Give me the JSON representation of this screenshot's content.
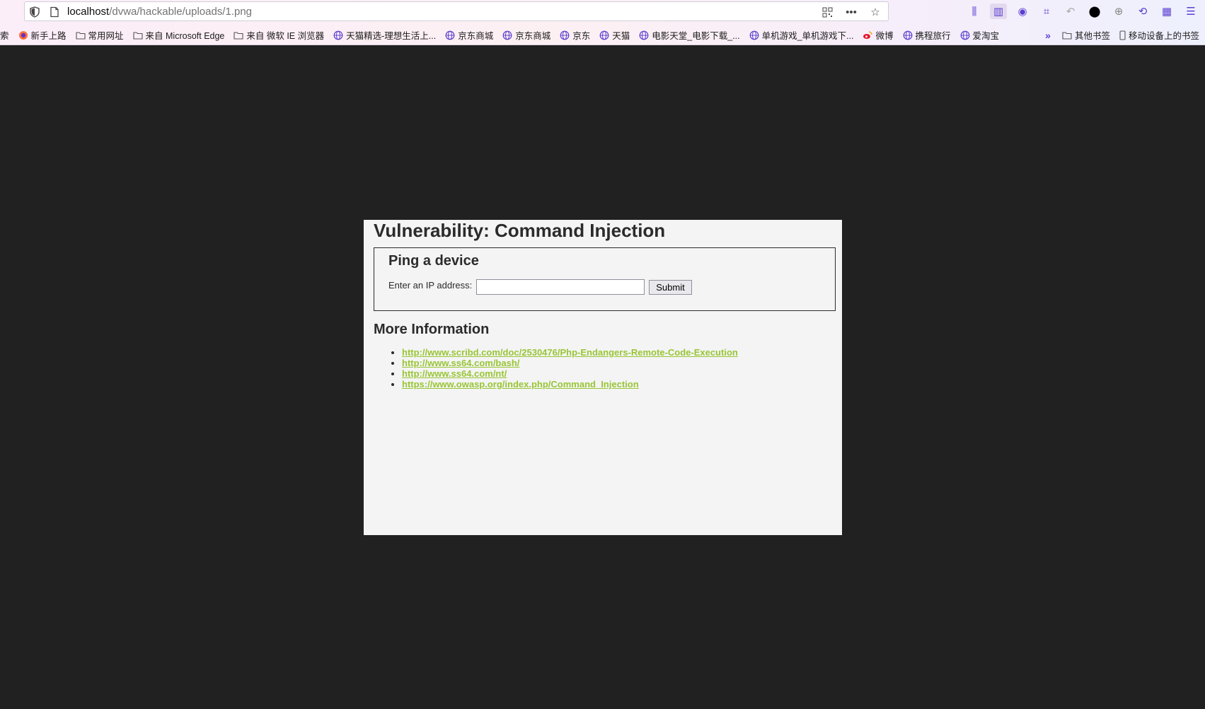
{
  "browser": {
    "url_host": "localhost",
    "url_path": "/dvwa/hackable/uploads/1.png",
    "bookmarks": [
      {
        "label": "索",
        "icon": "none"
      },
      {
        "label": "新手上路",
        "icon": "firefox-icon"
      },
      {
        "label": "常用网址",
        "icon": "folder-icon"
      },
      {
        "label": "来自 Microsoft Edge",
        "icon": "folder-icon"
      },
      {
        "label": "来自 微软 IE 浏览器",
        "icon": "folder-icon"
      },
      {
        "label": "天猫精选-理想生活上...",
        "icon": "globe-icon"
      },
      {
        "label": "京东商城",
        "icon": "globe-icon"
      },
      {
        "label": "京东商城",
        "icon": "globe-icon"
      },
      {
        "label": "京东",
        "icon": "globe-icon"
      },
      {
        "label": "天猫",
        "icon": "globe-icon"
      },
      {
        "label": "电影天堂_电影下载_...",
        "icon": "globe-icon"
      },
      {
        "label": "单机游戏_单机游戏下...",
        "icon": "globe-icon"
      },
      {
        "label": "微博",
        "icon": "weibo-icon"
      },
      {
        "label": "携程旅行",
        "icon": "globe-icon"
      },
      {
        "label": "爱淘宝",
        "icon": "globe-icon"
      }
    ],
    "other_bookmarks": "其他书签",
    "mobile_bookmarks": "移动设备上的书签"
  },
  "page": {
    "title": "Vulnerability: Command Injection",
    "form_heading": "Ping a device",
    "ip_label": "Enter an IP address:",
    "ip_value": "",
    "submit_label": "Submit",
    "more_heading": "More Information",
    "links": [
      "http://www.scribd.com/doc/2530476/Php-Endangers-Remote-Code-Execution",
      "http://www.ss64.com/bash/",
      "http://www.ss64.com/nt/",
      "https://www.owasp.org/index.php/Command_Injection"
    ]
  },
  "colors": {
    "page_bg": "#212121",
    "panel_bg": "#f4f4f4",
    "link": "#98c534",
    "toolbar_accent": "#5b3fd0"
  }
}
